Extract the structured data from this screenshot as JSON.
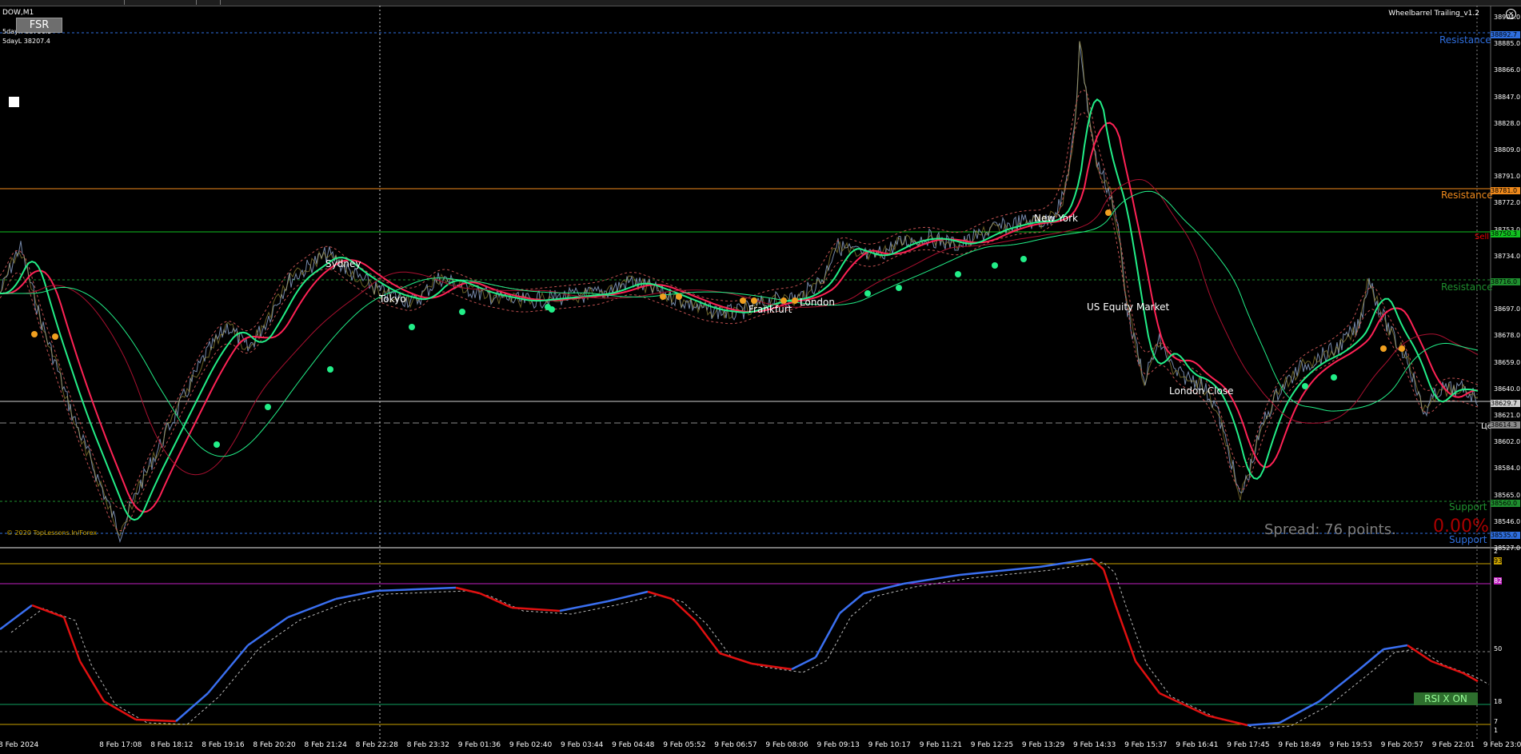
{
  "chart_header": {
    "symbol": "DOW,M1",
    "five_day_high": "5dayH 38750.5",
    "five_day_low": "5dayL 38207.4",
    "fsr_button": "FSR",
    "indicator_title": "Wheelbarrel Trailing_v1.2"
  },
  "sessions": [
    "Sydney",
    "Tokyo",
    "Frankfurt",
    "London",
    "New York",
    "US Equity Market",
    "London Close"
  ],
  "levels": {
    "resistance_blue": "Resistance",
    "resistance_orange": "Resistance",
    "resistance_green": "Resistance",
    "sell": "Sell",
    "support_green": "Support",
    "support_blue": "Support",
    "ce": "Це"
  },
  "copyright": "© 2020 TopLessons.In/Forex",
  "spread_text": "Spread: 76 points.",
  "percent_text": "0.00%",
  "rsi_button": "RSI X ON",
  "price_axis": {
    "ticks": [
      "38904.0",
      "38885.0",
      "38866.0",
      "38847.0",
      "38828.0",
      "38809.0",
      "38791.0",
      "38772.0",
      "38753.0",
      "38734.0",
      "38716.0",
      "38697.0",
      "38678.0",
      "38659.0",
      "38640.0",
      "38621.0",
      "38602.0",
      "38584.0",
      "38565.0",
      "38546.0",
      "38527.0"
    ],
    "tags": [
      {
        "text": "38892.7",
        "color": "#2f6fdf"
      },
      {
        "text": "38781.0",
        "color": "#f08a1c"
      },
      {
        "text": "38750.3",
        "color": "#11c020"
      },
      {
        "text": "38716.0",
        "color": "#1f8f2f"
      },
      {
        "text": "38629.7",
        "color": "#cfcfcf"
      },
      {
        "text": "38614.3",
        "color": "#8a8a8a"
      },
      {
        "text": "38560.0",
        "color": "#1f8f2f"
      },
      {
        "text": "38535.0",
        "color": "#2f6fdf"
      }
    ]
  },
  "rsi_axis": {
    "ticks": [
      "2",
      "93",
      "82",
      "50",
      "18",
      "7",
      "1"
    ],
    "tag_93": "93",
    "tag_82": "82"
  },
  "time_axis": [
    "8 Feb 2024",
    "8 Feb 17:08",
    "8 Feb 18:12",
    "8 Feb 19:16",
    "8 Feb 20:20",
    "8 Feb 21:24",
    "8 Feb 22:28",
    "8 Feb 23:32",
    "9 Feb 01:36",
    "9 Feb 02:40",
    "9 Feb 03:44",
    "9 Feb 04:48",
    "9 Feb 05:52",
    "9 Feb 06:57",
    "9 Feb 08:06",
    "9 Feb 09:13",
    "9 Feb 10:17",
    "9 Feb 11:21",
    "9 Feb 12:25",
    "9 Feb 13:29",
    "9 Feb 14:33",
    "9 Feb 15:37",
    "9 Feb 16:41",
    "9 Feb 17:45",
    "9 Feb 18:49",
    "9 Feb 19:53",
    "9 Feb 20:57",
    "9 Feb 22:01",
    "9 Feb 23:05"
  ],
  "colors": {
    "background": "#000000",
    "price": "#8aa0c8",
    "fast_ma": "#ff2255",
    "slow_ma": "#22ee88",
    "resistance_blue": "#2f6fdf",
    "resistance_orange": "#f08a1c",
    "sell_green": "#11c020",
    "rsi_up": "#3a6ff0",
    "rsi_down": "#e01010",
    "rsi_level_93": "#c8a000",
    "rsi_level_82": "#c020c0",
    "rsi_level_18": "#11a060"
  }
}
